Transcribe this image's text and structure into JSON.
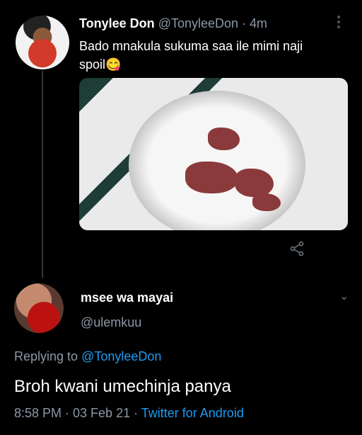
{
  "tweet": {
    "name": "Tonylee Don",
    "handle": "@TonyleeDon",
    "time_sep": " · ",
    "time": "4m",
    "text_line1": "Bado mnakula sukuma saa ile mimi naji",
    "text_line2": "spoil",
    "emoji": "😋"
  },
  "reply": {
    "name": "msee wa mayai",
    "handle": "@ulemkuu",
    "replying_prefix": "Replying to ",
    "replying_to": "@TonyleeDon",
    "text": "Broh kwani umechinja panya",
    "date": "8:58 PM · 03 Feb 21 · ",
    "source": "Twitter for Android"
  }
}
